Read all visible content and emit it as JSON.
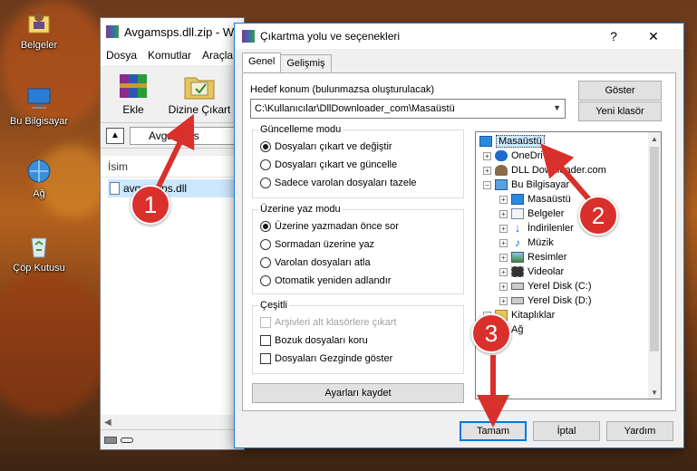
{
  "desktop": {
    "icons": [
      {
        "label": "Belgeler",
        "icon": "user-folder-icon"
      },
      {
        "label": "Bu Bilgisayar",
        "icon": "computer-icon"
      },
      {
        "label": "Ağ",
        "icon": "network-icon"
      },
      {
        "label": "Çöp Kutusu",
        "icon": "recycle-bin-icon"
      }
    ]
  },
  "winrar": {
    "title": "Avgamsps.dll.zip - W",
    "menu": [
      "Dosya",
      "Komutlar",
      "Araçla"
    ],
    "toolbar": {
      "add_label": "Ekle",
      "extract_label": "Dizine Çıkart"
    },
    "path": "Avgamsps",
    "column_name": "İsim",
    "file": "avgamsps.dll"
  },
  "dialog": {
    "title": "Çıkartma yolu ve seçenekleri",
    "help": "?",
    "close": "✕",
    "tabs": [
      "Genel",
      "Gelişmiş"
    ],
    "dest_label": "Hedef konum (bulunmazsa oluşturulacak)",
    "dest_value": "C:\\Kullanıcılar\\DllDownloader_com\\Masaüstü",
    "show_button": "Göster",
    "new_folder_button": "Yeni klasör",
    "update_mode": {
      "title": "Güncelleme modu",
      "options": [
        "Dosyaları çıkart ve değiştir",
        "Dosyaları çıkart ve güncelle",
        "Sadece varolan dosyaları tazele"
      ]
    },
    "overwrite_mode": {
      "title": "Üzerine yaz modu",
      "options": [
        "Üzerine yazmadan önce sor",
        "Sormadan üzerine yaz",
        "Varolan dosyaları atla",
        "Otomatik yeniden adlandır"
      ]
    },
    "misc": {
      "title": "Çeşitli",
      "options": [
        "Arşivleri alt klasörlere çıkart",
        "Bozuk dosyaları koru",
        "Dosyaları Gezginde göster"
      ]
    },
    "save_settings": "Ayarları kaydet",
    "tree": [
      "Masaüstü",
      "OneDrive",
      "DLL Downloader.com",
      "Bu Bilgisayar",
      "Masaüstü",
      "Belgeler",
      "İndirilenler",
      "Müzik",
      "Resimler",
      "Videolar",
      "Yerel Disk (C:)",
      "Yerel Disk (D:)",
      "Kitaplıklar",
      "Ağ"
    ],
    "ok": "Tamam",
    "cancel": "İptal",
    "help_button": "Yardım"
  },
  "annotations": [
    "1",
    "2",
    "3"
  ],
  "colors": {
    "badge": "#d9302c",
    "selection": "#cce8ff",
    "accent": "#0078d7"
  }
}
